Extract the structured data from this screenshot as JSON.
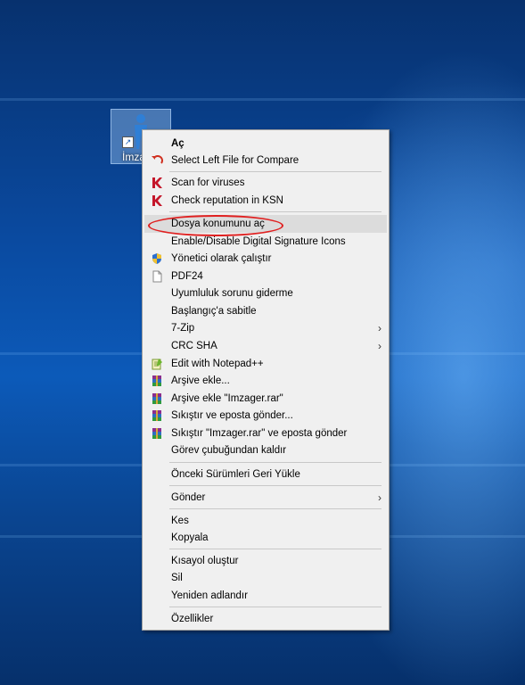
{
  "desktop": {
    "icon_label": "İmza"
  },
  "menu": {
    "items": [
      {
        "label": "Aç",
        "icon": "none"
      },
      {
        "label": "Select Left File for Compare",
        "icon": "compare-arrow-icon"
      },
      {
        "label": "Scan for viruses",
        "icon": "kaspersky-icon"
      },
      {
        "label": "Check reputation in KSN",
        "icon": "kaspersky-icon"
      },
      {
        "label": "Dosya konumunu aç",
        "icon": "none"
      },
      {
        "label": "Enable/Disable Digital Signature Icons",
        "icon": "none"
      },
      {
        "label": "Yönetici olarak çalıştır",
        "icon": "uac-shield-icon"
      },
      {
        "label": "PDF24",
        "icon": "document-icon"
      },
      {
        "label": "Uyumluluk sorunu giderme",
        "icon": "none"
      },
      {
        "label": "Başlangıç'a sabitle",
        "icon": "none"
      },
      {
        "label": "7-Zip",
        "icon": "none"
      },
      {
        "label": "CRC SHA",
        "icon": "none"
      },
      {
        "label": "Edit with Notepad++",
        "icon": "notepad-plus-icon"
      },
      {
        "label": "Arşive ekle...",
        "icon": "winrar-icon"
      },
      {
        "label": "Arşive ekle \"Imzager.rar\"",
        "icon": "winrar-icon"
      },
      {
        "label": "Sıkıştır ve eposta gönder...",
        "icon": "winrar-icon"
      },
      {
        "label": "Sıkıştır \"Imzager.rar\" ve eposta gönder",
        "icon": "winrar-icon"
      },
      {
        "label": "Görev çubuğundan kaldır",
        "icon": "none"
      },
      {
        "label": "Önceki Sürümleri Geri Yükle",
        "icon": "none"
      },
      {
        "label": "Gönder",
        "icon": "none"
      },
      {
        "label": "Kes",
        "icon": "none"
      },
      {
        "label": "Kopyala",
        "icon": "none"
      },
      {
        "label": "Kısayol oluştur",
        "icon": "none"
      },
      {
        "label": "Sil",
        "icon": "none"
      },
      {
        "label": "Yeniden adlandır",
        "icon": "none"
      },
      {
        "label": "Özellikler",
        "icon": "none"
      }
    ],
    "submenu_arrow": "›"
  },
  "colors": {
    "annotation": "#e02020",
    "highlight": "#dcdcdc"
  }
}
